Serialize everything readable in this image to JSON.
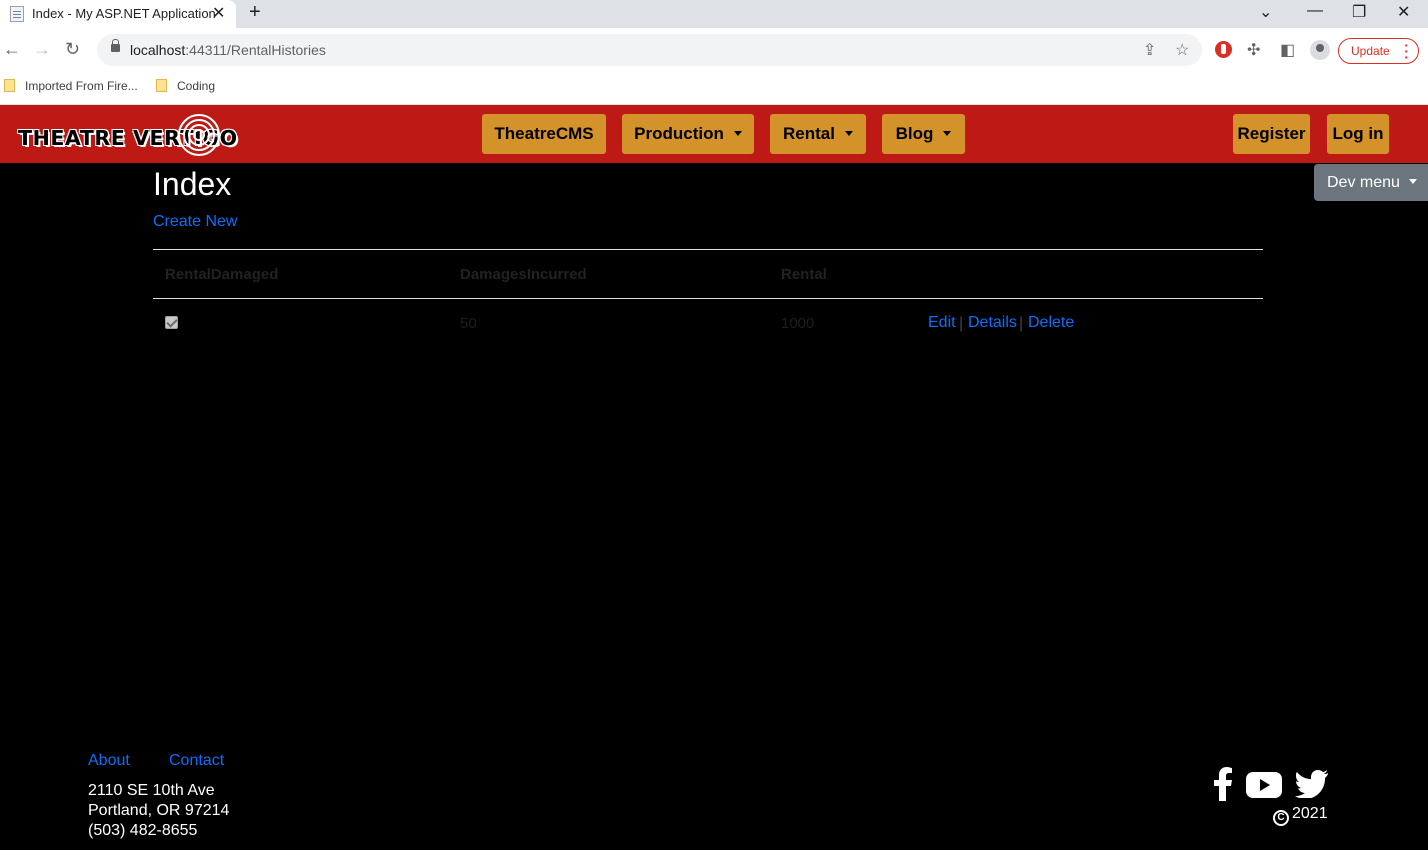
{
  "browser": {
    "tab_title": "Index - My ASP.NET Application",
    "url_host": "localhost",
    "url_path": ":44311/RentalHistories",
    "update_label": "Update",
    "bookmarks": [
      "Imported From Fire...",
      "Coding"
    ]
  },
  "navbar": {
    "logo_text": "THEATRE VERTIGO",
    "items": [
      {
        "label": "TheatreCMS"
      },
      {
        "label": "Production"
      },
      {
        "label": "Rental"
      },
      {
        "label": "Blog"
      }
    ],
    "register_label": "Register",
    "login_label": "Log in",
    "dev_menu_label": "Dev menu"
  },
  "main": {
    "title": "Index",
    "create_new_label": "Create New",
    "columns": [
      "RentalDamaged",
      "DamagesIncurred",
      "Rental"
    ],
    "rows": [
      {
        "rental_damaged": true,
        "damages_incurred": "50",
        "rental": "1000"
      }
    ],
    "actions": {
      "edit": "Edit",
      "details": "Details",
      "delete": "Delete",
      "separator": "|"
    }
  },
  "footer": {
    "about_label": "About",
    "contact_label": "Contact",
    "address_line1": "2110 SE 10th Ave",
    "address_line2": "Portland, OR 97214",
    "phone": "(503) 482-8655",
    "copyright_year": "2021",
    "social_icons": [
      "facebook-icon",
      "youtube-icon",
      "twitter-icon"
    ]
  },
  "colors": {
    "navbar_bg": "#bd1915",
    "nav_button": "#d4922b",
    "link": "#0d6efd",
    "dev_menu_bg": "#6c757d",
    "page_bg": "#000000"
  }
}
